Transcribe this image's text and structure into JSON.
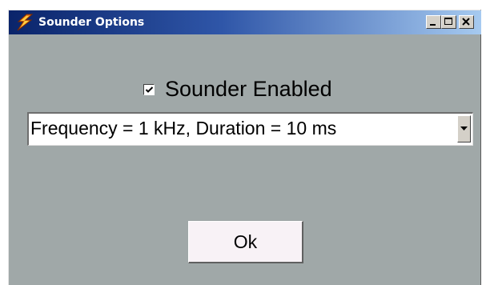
{
  "window": {
    "title": "Sounder Options",
    "icon": "lightning-bolt-icon",
    "controls": {
      "minimize": "minimize-icon",
      "maximize": "maximize-icon",
      "close": "close-icon"
    }
  },
  "sounder": {
    "enabled_label": "Sounder Enabled",
    "enabled": true
  },
  "setting": {
    "selected": "Frequency = 1 kHz, Duration = 10 ms"
  },
  "actions": {
    "ok_label": "Ok"
  },
  "colors": {
    "dialog_background": "#a0a8a8",
    "titlebar_start": "#0a246a",
    "titlebar_end": "#a6caf0",
    "ok_button_face": "#f8f2f6"
  }
}
